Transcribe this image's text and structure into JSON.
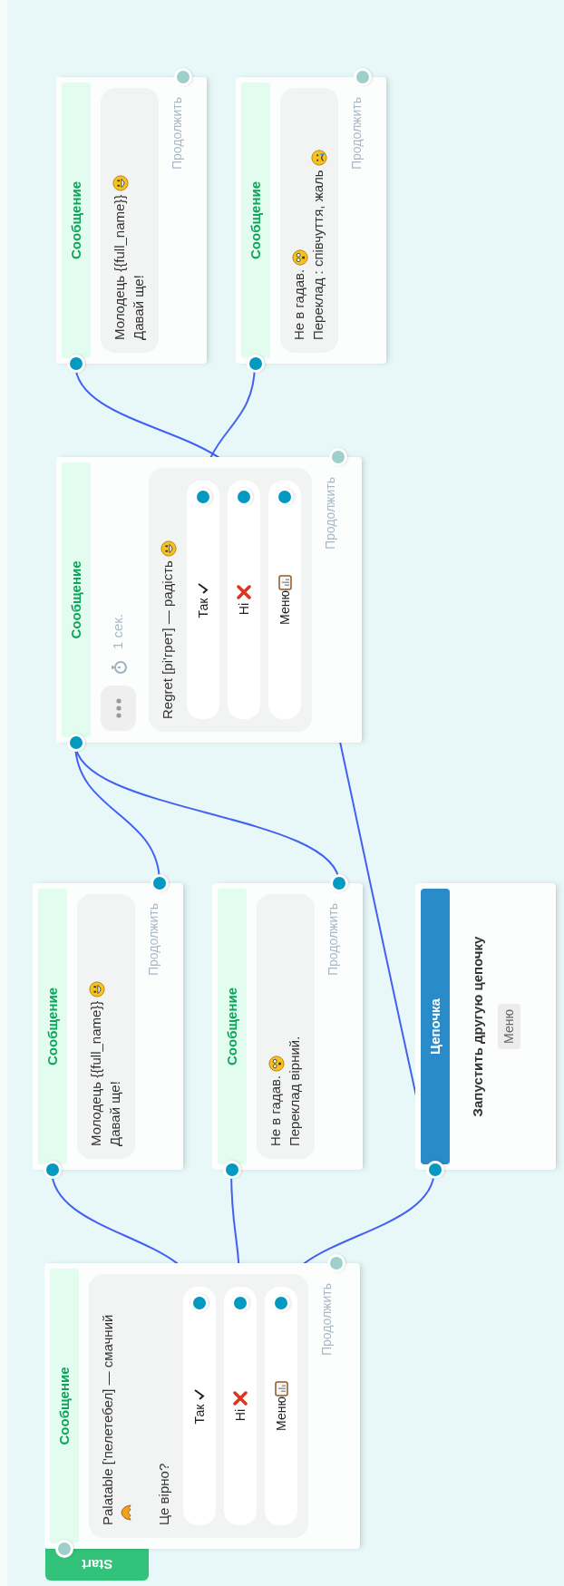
{
  "nodes": [
    {
      "kind": "message",
      "badge": "Start",
      "title": "Сообщение",
      "input_connected": false,
      "lines": [
        "Palatable ['пелетебел] — смачний",
        "Це вірно?"
      ],
      "buttons": [
        {
          "label": "Так",
          "connected": true
        },
        {
          "label": "Ні",
          "connected": true
        },
        {
          "label": "Меню",
          "connected": true
        }
      ],
      "continue": {
        "label": "Продолжить",
        "connected": false
      }
    },
    {
      "kind": "message",
      "title": "Сообщение",
      "input_connected": true,
      "lines": [
        "Молодець  {{full_name}}",
        "Давай ще!"
      ],
      "continue": {
        "label": "Продолжить",
        "connected": true
      }
    },
    {
      "kind": "message",
      "title": "Сообщение",
      "input_connected": true,
      "lines": [
        "Не в гадав.",
        "Переклад вірний."
      ],
      "continue": {
        "label": "Продолжить",
        "connected": true
      }
    },
    {
      "kind": "chain",
      "title": "Цепочка",
      "input_connected": true,
      "action": "Запустить другую цепочку",
      "target": "Меню"
    },
    {
      "kind": "message",
      "title": "Сообщение",
      "input_connected": true,
      "delay": "1 сек.",
      "lines": [
        "Regret [рі'грет] — радість"
      ],
      "buttons": [
        {
          "label": "Так",
          "connected": true
        },
        {
          "label": "Ні",
          "connected": true
        },
        {
          "label": "Меню",
          "connected": true
        }
      ],
      "continue": {
        "label": "Продолжить",
        "connected": false
      }
    },
    {
      "kind": "message",
      "title": "Сообщение",
      "input_connected": true,
      "lines": [
        "Молодець  {{full_name}}",
        "Давай ще!"
      ],
      "continue": {
        "label": "Продолжить",
        "connected": false
      }
    },
    {
      "kind": "message",
      "title": "Сообщение",
      "input_connected": true,
      "lines": [
        "Не в гадав.",
        "Переклад : співчуття, жаль"
      ],
      "continue": {
        "label": "Продолжить",
        "connected": false
      }
    }
  ]
}
